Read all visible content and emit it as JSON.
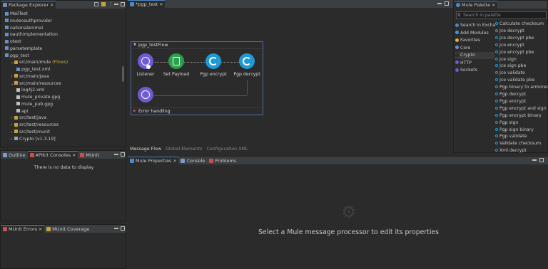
{
  "package_explorer": {
    "tab_label": "Package Explorer",
    "items": [
      {
        "label": "MailTest",
        "indent": 0,
        "kind": "project"
      },
      {
        "label": "muleoauthprovider",
        "indent": 0,
        "kind": "project"
      },
      {
        "label": "nationalanimal",
        "indent": 0,
        "kind": "project"
      },
      {
        "label": "oauthimplementation",
        "indent": 0,
        "kind": "project"
      },
      {
        "label": "otest",
        "indent": 0,
        "kind": "project"
      },
      {
        "label": "parsetemplate",
        "indent": 0,
        "kind": "project"
      },
      {
        "label": "pgp_test",
        "indent": 0,
        "kind": "project"
      },
      {
        "label": "src/main/mule",
        "suffix": "(Flows)",
        "indent": 1,
        "kind": "folder"
      },
      {
        "label": "pgp_test.xml",
        "indent": 2,
        "kind": "xml"
      },
      {
        "label": "src/main/java",
        "indent": 1,
        "kind": "folder"
      },
      {
        "label": "src/main/resources",
        "indent": 1,
        "kind": "folder"
      },
      {
        "label": "log4j2.xml",
        "indent": 2,
        "kind": "file"
      },
      {
        "label": "mule_private.gpg",
        "indent": 2,
        "kind": "file"
      },
      {
        "label": "mule_pub.gpg",
        "indent": 2,
        "kind": "file"
      },
      {
        "label": "api",
        "indent": 2,
        "kind": "file"
      },
      {
        "label": "src/test/java",
        "indent": 1,
        "kind": "folder"
      },
      {
        "label": "src/test/resources",
        "indent": 1,
        "kind": "folder"
      },
      {
        "label": "src/test/munit",
        "indent": 1,
        "kind": "folder"
      },
      {
        "label": "Crypto [v1.3.19]",
        "indent": 1,
        "kind": "lib"
      }
    ]
  },
  "apikit_panel": {
    "tabs": [
      "Outline",
      "APIkit Consoles",
      "MUnit"
    ],
    "empty_text": "There is no data to display"
  },
  "munit_panel": {
    "tabs": [
      "MUnit Errors",
      "MUnit Coverage"
    ]
  },
  "editor": {
    "tab_label": "*pgp_test",
    "flow_name": "pgp_testFlow",
    "components": [
      {
        "label": "Listener",
        "color": "#6e5bd6"
      },
      {
        "label": "Set Payload",
        "color": "#2aa14b"
      },
      {
        "label": "Pgp encrypt",
        "color": "#1f9ad6"
      },
      {
        "label": "Pgp decrypt",
        "color": "#1f9ad6"
      }
    ],
    "error_handling_label": "Error handling",
    "bottom_tabs": [
      "Message Flow",
      "Global Elements",
      "Configuration XML"
    ]
  },
  "properties": {
    "tabs": [
      "Mule Properties",
      "Console",
      "Problems"
    ],
    "empty_message": "Select a Mule message processor to edit its properties"
  },
  "palette": {
    "tab_label": "Mule Palette",
    "search_placeholder": "Search in palette",
    "categories": [
      "Search in Excha",
      "Add Modules",
      "Favorites",
      "Core",
      "Crypto",
      "HTTP",
      "Sockets"
    ],
    "operations": [
      "Calculate checksum",
      "Jce decrypt",
      "Jce decrypt pbe",
      "Jce encrypt",
      "Jce encrypt pbe",
      "Jce sign",
      "Jce sign pbe",
      "Jce validate",
      "Jce validate pbe",
      "Pgp binary to armored",
      "Pgp decrypt",
      "Pgp encrypt",
      "Pgp encrypt and sign",
      "Pgp encrypt binary",
      "Pgp sign",
      "Pgp sign binary",
      "Pgp validate",
      "Validate checksum",
      "Xml decrypt"
    ]
  }
}
